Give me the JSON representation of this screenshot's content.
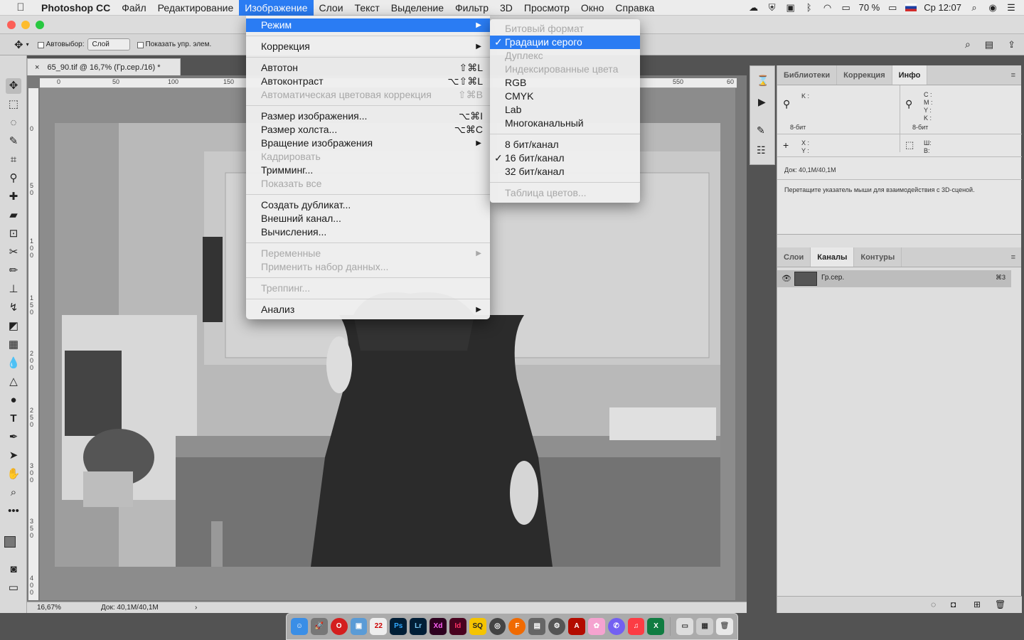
{
  "menubar": {
    "apple": "",
    "items": [
      "Photoshop CC",
      "Файл",
      "Редактирование",
      "Изображение",
      "Слои",
      "Текст",
      "Выделение",
      "Фильтр",
      "3D",
      "Просмотр",
      "Окно",
      "Справка"
    ],
    "battery": "70 %",
    "clock": "Ср 12:07"
  },
  "options": {
    "autoselect_label": "Автовыбор:",
    "autoselect_value": "Слой",
    "show_controls_label": "Показать упр. элем."
  },
  "document": {
    "tab_title": "65_90.tif @ 16,7% (Гр.сер./16) *",
    "zoom": "16,67%",
    "doc_size": "Док: 40,1M/40,1M",
    "ruler_h": [
      "0",
      "50",
      "100",
      "150",
      "550",
      "60"
    ],
    "ruler_v": [
      "0",
      "5 0",
      "1 0 0",
      "1 5 0",
      "2 0 0",
      "2 5 0",
      "3 0 0",
      "3 5 0",
      "4 0 0"
    ]
  },
  "image_menu": {
    "items": [
      {
        "label": "Режим",
        "arrow": true,
        "highlight": true
      },
      {
        "sep": true
      },
      {
        "label": "Коррекция",
        "arrow": true
      },
      {
        "sep": true
      },
      {
        "label": "Автотон",
        "shortcut": "⇧⌘L"
      },
      {
        "label": "Автоконтраст",
        "shortcut": "⌥⇧⌘L"
      },
      {
        "label": "Автоматическая цветовая коррекция",
        "shortcut": "⇧⌘B",
        "disabled": true
      },
      {
        "sep": true
      },
      {
        "label": "Размер изображения...",
        "shortcut": "⌥⌘I"
      },
      {
        "label": "Размер холста...",
        "shortcut": "⌥⌘C"
      },
      {
        "label": "Вращение изображения",
        "arrow": true
      },
      {
        "label": "Кадрировать",
        "disabled": true
      },
      {
        "label": "Тримминг..."
      },
      {
        "label": "Показать все",
        "disabled": true
      },
      {
        "sep": true
      },
      {
        "label": "Создать дубликат..."
      },
      {
        "label": "Внешний канал..."
      },
      {
        "label": "Вычисления..."
      },
      {
        "sep": true
      },
      {
        "label": "Переменные",
        "arrow": true,
        "disabled": true
      },
      {
        "label": "Применить набор данных...",
        "disabled": true
      },
      {
        "sep": true
      },
      {
        "label": "Треппинг...",
        "disabled": true
      },
      {
        "sep": true
      },
      {
        "label": "Анализ",
        "arrow": true
      }
    ]
  },
  "mode_menu": {
    "items": [
      {
        "label": "Битовый формат",
        "disabled": true
      },
      {
        "label": "Градации серого",
        "checked": true,
        "highlight": true
      },
      {
        "label": "Дуплекс",
        "disabled": true
      },
      {
        "label": "Индексированные цвета",
        "disabled": true
      },
      {
        "label": "RGB"
      },
      {
        "label": "CMYK"
      },
      {
        "label": "Lab"
      },
      {
        "label": "Многоканальный"
      },
      {
        "sep": true
      },
      {
        "label": "8 бит/канал"
      },
      {
        "label": "16 бит/канал",
        "checked": true
      },
      {
        "label": "32 бит/канал"
      },
      {
        "sep": true
      },
      {
        "label": "Таблица цветов...",
        "disabled": true
      }
    ]
  },
  "info_panel": {
    "tabs": [
      "Библиотеки",
      "Коррекция",
      "Инфо"
    ],
    "k_label": "K :",
    "bits_left": "8-бит",
    "cmyk_labels": "C :\nM :\nY :\nK :",
    "bits_right": "8-бит",
    "xy_labels": "X :\nY :",
    "wh_labels": "Ш:\nВ:",
    "doc": "Док: 40,1M/40,1M",
    "hint": "Перетащите указатель мыши для взаимодействия с 3D-сценой."
  },
  "channels_panel": {
    "tabs": [
      "Слои",
      "Каналы",
      "Контуры"
    ],
    "channel_name": "Гр.сер.",
    "channel_shortcut": "⌘3"
  },
  "colors": {
    "accent": "#2a7cf3"
  }
}
